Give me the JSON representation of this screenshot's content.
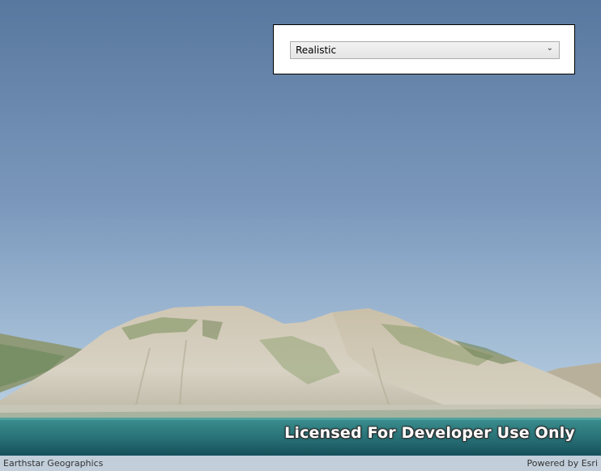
{
  "scene": {
    "watermark": "Licensed For Developer Use Only",
    "sky_top_color": "#5a7aa5",
    "sky_horizon_color": "#b9cfe3",
    "water_color": "#2f7c80"
  },
  "lighting_panel": {
    "selected_option": "Realistic",
    "arrow_icon": "chevron-down-icon"
  },
  "attribution": {
    "source": "Earthstar Geographics",
    "powered_by": "Powered by Esri"
  }
}
